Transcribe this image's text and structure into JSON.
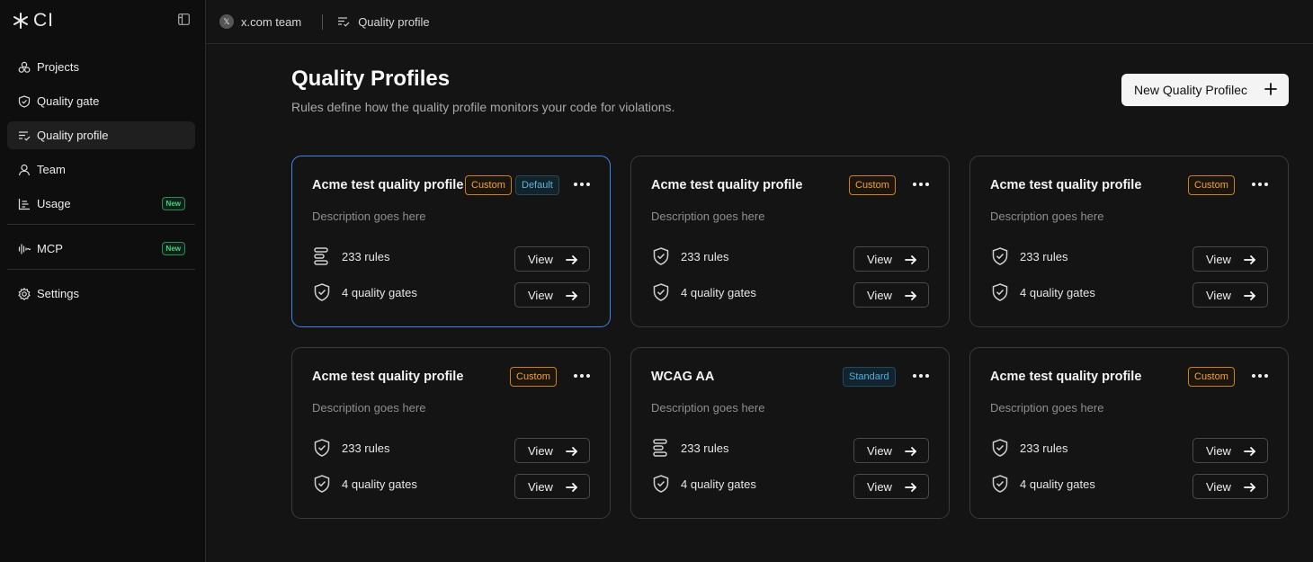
{
  "app": {
    "logo_text": "CI"
  },
  "sidebar": {
    "items": [
      {
        "label": "Projects",
        "icon": "projects-icon"
      },
      {
        "label": "Quality gate",
        "icon": "shield-check-icon"
      },
      {
        "label": "Quality profile",
        "icon": "list-check-icon",
        "active": true
      },
      {
        "label": "Team",
        "icon": "user-icon"
      },
      {
        "label": "Usage",
        "icon": "chart-icon",
        "badge": "New"
      }
    ],
    "items2": [
      {
        "label": "MCP",
        "icon": "waveform-icon",
        "badge": "New"
      }
    ],
    "items3": [
      {
        "label": "Settings",
        "icon": "gear-icon"
      }
    ]
  },
  "topbar": {
    "team": "x.com team",
    "team_avatar": "𝕏",
    "crumb": "Quality profile"
  },
  "main": {
    "title": "Quality Profiles",
    "subtitle": "Rules define how the quality profile monitors your code for violations.",
    "new_button": "New Quality Profilec"
  },
  "cards": [
    {
      "title": "Acme test quality profile",
      "tags": [
        "Custom",
        "Default"
      ],
      "description": "Description goes here",
      "rules": "233 rules",
      "gates": "4 quality gates",
      "view": "View",
      "rules_icon": "rules-list-icon"
    },
    {
      "title": "Acme test quality profile",
      "tags": [
        "Custom"
      ],
      "description": "Description goes here",
      "rules": "233 rules",
      "gates": "4 quality gates",
      "view": "View",
      "rules_icon": "shield-check-icon"
    },
    {
      "title": "Acme test quality profile",
      "tags": [
        "Custom"
      ],
      "description": "Description goes here",
      "rules": "233 rules",
      "gates": "4 quality gates",
      "view": "View",
      "rules_icon": "shield-check-icon"
    },
    {
      "title": "Acme test quality profile",
      "tags": [
        "Custom"
      ],
      "description": "Description goes here",
      "rules": "233 rules",
      "gates": "4 quality gates",
      "view": "View",
      "rules_icon": "shield-check-icon"
    },
    {
      "title": "WCAG AA",
      "tags": [
        "Standard"
      ],
      "description": "Description goes here",
      "rules": "233 rules",
      "gates": "4 quality gates",
      "view": "View",
      "rules_icon": "rules-list-icon"
    },
    {
      "title": "Acme test quality profile",
      "tags": [
        "Custom"
      ],
      "description": "Description goes here",
      "rules": "233 rules",
      "gates": "4 quality gates",
      "view": "View",
      "rules_icon": "shield-check-icon"
    }
  ],
  "colors": {
    "accent": "#3d86e8",
    "custom": "#f0a23c",
    "default": "#5ab5d8",
    "new_badge": "#4ad07a"
  }
}
